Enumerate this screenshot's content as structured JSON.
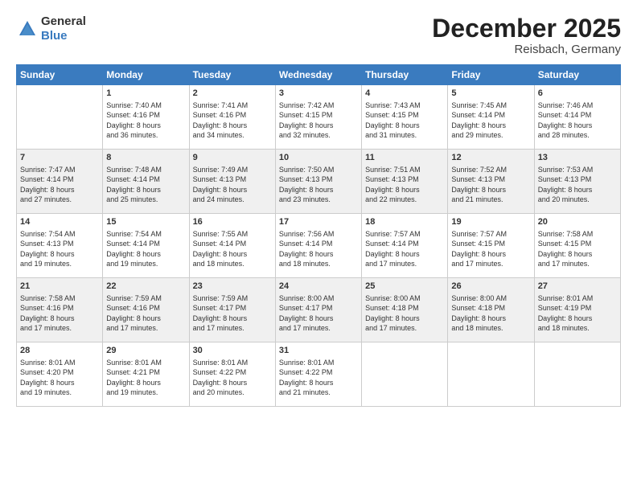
{
  "header": {
    "logo_general": "General",
    "logo_blue": "Blue",
    "month": "December 2025",
    "location": "Reisbach, Germany"
  },
  "days_of_week": [
    "Sunday",
    "Monday",
    "Tuesday",
    "Wednesday",
    "Thursday",
    "Friday",
    "Saturday"
  ],
  "weeks": [
    [
      {
        "day": "",
        "lines": []
      },
      {
        "day": "1",
        "lines": [
          "Sunrise: 7:40 AM",
          "Sunset: 4:16 PM",
          "Daylight: 8 hours",
          "and 36 minutes."
        ]
      },
      {
        "day": "2",
        "lines": [
          "Sunrise: 7:41 AM",
          "Sunset: 4:16 PM",
          "Daylight: 8 hours",
          "and 34 minutes."
        ]
      },
      {
        "day": "3",
        "lines": [
          "Sunrise: 7:42 AM",
          "Sunset: 4:15 PM",
          "Daylight: 8 hours",
          "and 32 minutes."
        ]
      },
      {
        "day": "4",
        "lines": [
          "Sunrise: 7:43 AM",
          "Sunset: 4:15 PM",
          "Daylight: 8 hours",
          "and 31 minutes."
        ]
      },
      {
        "day": "5",
        "lines": [
          "Sunrise: 7:45 AM",
          "Sunset: 4:14 PM",
          "Daylight: 8 hours",
          "and 29 minutes."
        ]
      },
      {
        "day": "6",
        "lines": [
          "Sunrise: 7:46 AM",
          "Sunset: 4:14 PM",
          "Daylight: 8 hours",
          "and 28 minutes."
        ]
      }
    ],
    [
      {
        "day": "7",
        "lines": [
          "Sunrise: 7:47 AM",
          "Sunset: 4:14 PM",
          "Daylight: 8 hours",
          "and 27 minutes."
        ]
      },
      {
        "day": "8",
        "lines": [
          "Sunrise: 7:48 AM",
          "Sunset: 4:14 PM",
          "Daylight: 8 hours",
          "and 25 minutes."
        ]
      },
      {
        "day": "9",
        "lines": [
          "Sunrise: 7:49 AM",
          "Sunset: 4:13 PM",
          "Daylight: 8 hours",
          "and 24 minutes."
        ]
      },
      {
        "day": "10",
        "lines": [
          "Sunrise: 7:50 AM",
          "Sunset: 4:13 PM",
          "Daylight: 8 hours",
          "and 23 minutes."
        ]
      },
      {
        "day": "11",
        "lines": [
          "Sunrise: 7:51 AM",
          "Sunset: 4:13 PM",
          "Daylight: 8 hours",
          "and 22 minutes."
        ]
      },
      {
        "day": "12",
        "lines": [
          "Sunrise: 7:52 AM",
          "Sunset: 4:13 PM",
          "Daylight: 8 hours",
          "and 21 minutes."
        ]
      },
      {
        "day": "13",
        "lines": [
          "Sunrise: 7:53 AM",
          "Sunset: 4:13 PM",
          "Daylight: 8 hours",
          "and 20 minutes."
        ]
      }
    ],
    [
      {
        "day": "14",
        "lines": [
          "Sunrise: 7:54 AM",
          "Sunset: 4:13 PM",
          "Daylight: 8 hours",
          "and 19 minutes."
        ]
      },
      {
        "day": "15",
        "lines": [
          "Sunrise: 7:54 AM",
          "Sunset: 4:14 PM",
          "Daylight: 8 hours",
          "and 19 minutes."
        ]
      },
      {
        "day": "16",
        "lines": [
          "Sunrise: 7:55 AM",
          "Sunset: 4:14 PM",
          "Daylight: 8 hours",
          "and 18 minutes."
        ]
      },
      {
        "day": "17",
        "lines": [
          "Sunrise: 7:56 AM",
          "Sunset: 4:14 PM",
          "Daylight: 8 hours",
          "and 18 minutes."
        ]
      },
      {
        "day": "18",
        "lines": [
          "Sunrise: 7:57 AM",
          "Sunset: 4:14 PM",
          "Daylight: 8 hours",
          "and 17 minutes."
        ]
      },
      {
        "day": "19",
        "lines": [
          "Sunrise: 7:57 AM",
          "Sunset: 4:15 PM",
          "Daylight: 8 hours",
          "and 17 minutes."
        ]
      },
      {
        "day": "20",
        "lines": [
          "Sunrise: 7:58 AM",
          "Sunset: 4:15 PM",
          "Daylight: 8 hours",
          "and 17 minutes."
        ]
      }
    ],
    [
      {
        "day": "21",
        "lines": [
          "Sunrise: 7:58 AM",
          "Sunset: 4:16 PM",
          "Daylight: 8 hours",
          "and 17 minutes."
        ]
      },
      {
        "day": "22",
        "lines": [
          "Sunrise: 7:59 AM",
          "Sunset: 4:16 PM",
          "Daylight: 8 hours",
          "and 17 minutes."
        ]
      },
      {
        "day": "23",
        "lines": [
          "Sunrise: 7:59 AM",
          "Sunset: 4:17 PM",
          "Daylight: 8 hours",
          "and 17 minutes."
        ]
      },
      {
        "day": "24",
        "lines": [
          "Sunrise: 8:00 AM",
          "Sunset: 4:17 PM",
          "Daylight: 8 hours",
          "and 17 minutes."
        ]
      },
      {
        "day": "25",
        "lines": [
          "Sunrise: 8:00 AM",
          "Sunset: 4:18 PM",
          "Daylight: 8 hours",
          "and 17 minutes."
        ]
      },
      {
        "day": "26",
        "lines": [
          "Sunrise: 8:00 AM",
          "Sunset: 4:18 PM",
          "Daylight: 8 hours",
          "and 18 minutes."
        ]
      },
      {
        "day": "27",
        "lines": [
          "Sunrise: 8:01 AM",
          "Sunset: 4:19 PM",
          "Daylight: 8 hours",
          "and 18 minutes."
        ]
      }
    ],
    [
      {
        "day": "28",
        "lines": [
          "Sunrise: 8:01 AM",
          "Sunset: 4:20 PM",
          "Daylight: 8 hours",
          "and 19 minutes."
        ]
      },
      {
        "day": "29",
        "lines": [
          "Sunrise: 8:01 AM",
          "Sunset: 4:21 PM",
          "Daylight: 8 hours",
          "and 19 minutes."
        ]
      },
      {
        "day": "30",
        "lines": [
          "Sunrise: 8:01 AM",
          "Sunset: 4:22 PM",
          "Daylight: 8 hours",
          "and 20 minutes."
        ]
      },
      {
        "day": "31",
        "lines": [
          "Sunrise: 8:01 AM",
          "Sunset: 4:22 PM",
          "Daylight: 8 hours",
          "and 21 minutes."
        ]
      },
      {
        "day": "",
        "lines": []
      },
      {
        "day": "",
        "lines": []
      },
      {
        "day": "",
        "lines": []
      }
    ]
  ]
}
